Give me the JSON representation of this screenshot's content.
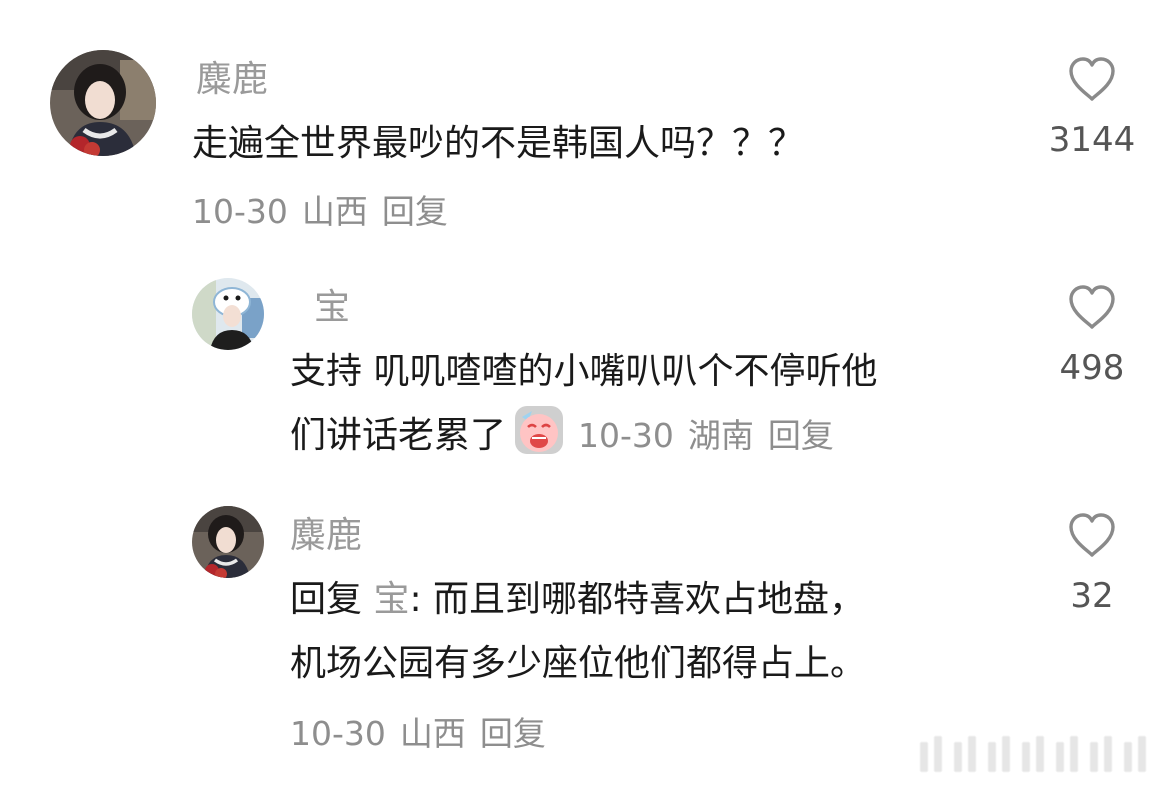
{
  "comments": [
    {
      "username": "麋鹿",
      "text": "走遍全世界最吵的不是韩国人吗？？？",
      "date": "10-30",
      "location": "山西",
      "reply_label": "回复",
      "likes": "3144"
    },
    {
      "username": "宝",
      "text_line1": "支持 叽叽喳喳的小嘴叭叭个不停听他",
      "text_line2": "们讲话老累了",
      "emoji": "sad-face-emoji",
      "date": "10-30",
      "location": "湖南",
      "reply_label": "回复",
      "likes": "498"
    },
    {
      "username": "麋鹿",
      "reply_prefix": "回复",
      "reply_to": "宝",
      "text_line1": ": 而且到哪都特喜欢占地盘，",
      "text_line2": "机场公园有多少座位他们都得占上。",
      "date": "10-30",
      "location": "山西",
      "reply_label": "回复",
      "likes": "32"
    }
  ],
  "colors": {
    "text": "#1a1a1a",
    "secondary": "#8e8e8e",
    "heart_outline": "#8a8a8a"
  }
}
